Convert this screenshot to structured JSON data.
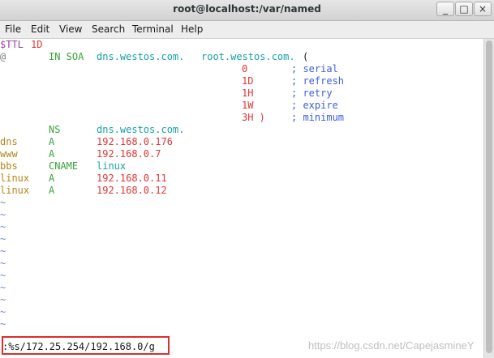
{
  "window": {
    "title": "root@localhost:/var/named",
    "minimize_glyph": "_",
    "maximize_glyph": "□",
    "close_glyph": "×"
  },
  "menu": [
    "File",
    "Edit",
    "View",
    "Search",
    "Terminal",
    "Help"
  ],
  "zone": {
    "ttl_directive": "$TTL",
    "ttl_value": "1D",
    "soa": {
      "origin": "@",
      "type": "IN SOA",
      "primary_ns": "dns.westos.com.",
      "admin": "root.westos.com.",
      "open": "("
    },
    "soa_fields": [
      {
        "value": "0",
        "comment": "; serial"
      },
      {
        "value": "1D",
        "comment": "; refresh"
      },
      {
        "value": "1H",
        "comment": "; retry"
      },
      {
        "value": "1W",
        "comment": "; expire"
      },
      {
        "value": "3H )",
        "comment": "; minimum"
      }
    ],
    "ns_record": {
      "type": "NS",
      "value": "dns.westos.com."
    },
    "records": [
      {
        "name": "dns",
        "type": "A",
        "value": "192.168.0.176"
      },
      {
        "name": "www",
        "type": "A",
        "value": "192.168.0.7"
      },
      {
        "name": "bbs",
        "type": "CNAME",
        "value": "linux"
      },
      {
        "name": "linux",
        "type": "A",
        "value": "192.168.0.11"
      },
      {
        "name": "linux",
        "type": "A",
        "value": "192.168.0.12"
      }
    ]
  },
  "empty_line_marker": "~",
  "command_line": ":%s/172.25.254/192.168.0/g",
  "watermark": "https://blog.csdn.net/CapejasmineY",
  "colors": {
    "directive": "#a040a0",
    "number": "#e23434",
    "type": "#3aa33a",
    "domain": "#16a0a0",
    "name": "#b3861c",
    "comment": "#3f5fd8",
    "origin": "#7d7d7d",
    "tilde": "#6f86d6",
    "highlight_box": "#e12b2b"
  }
}
